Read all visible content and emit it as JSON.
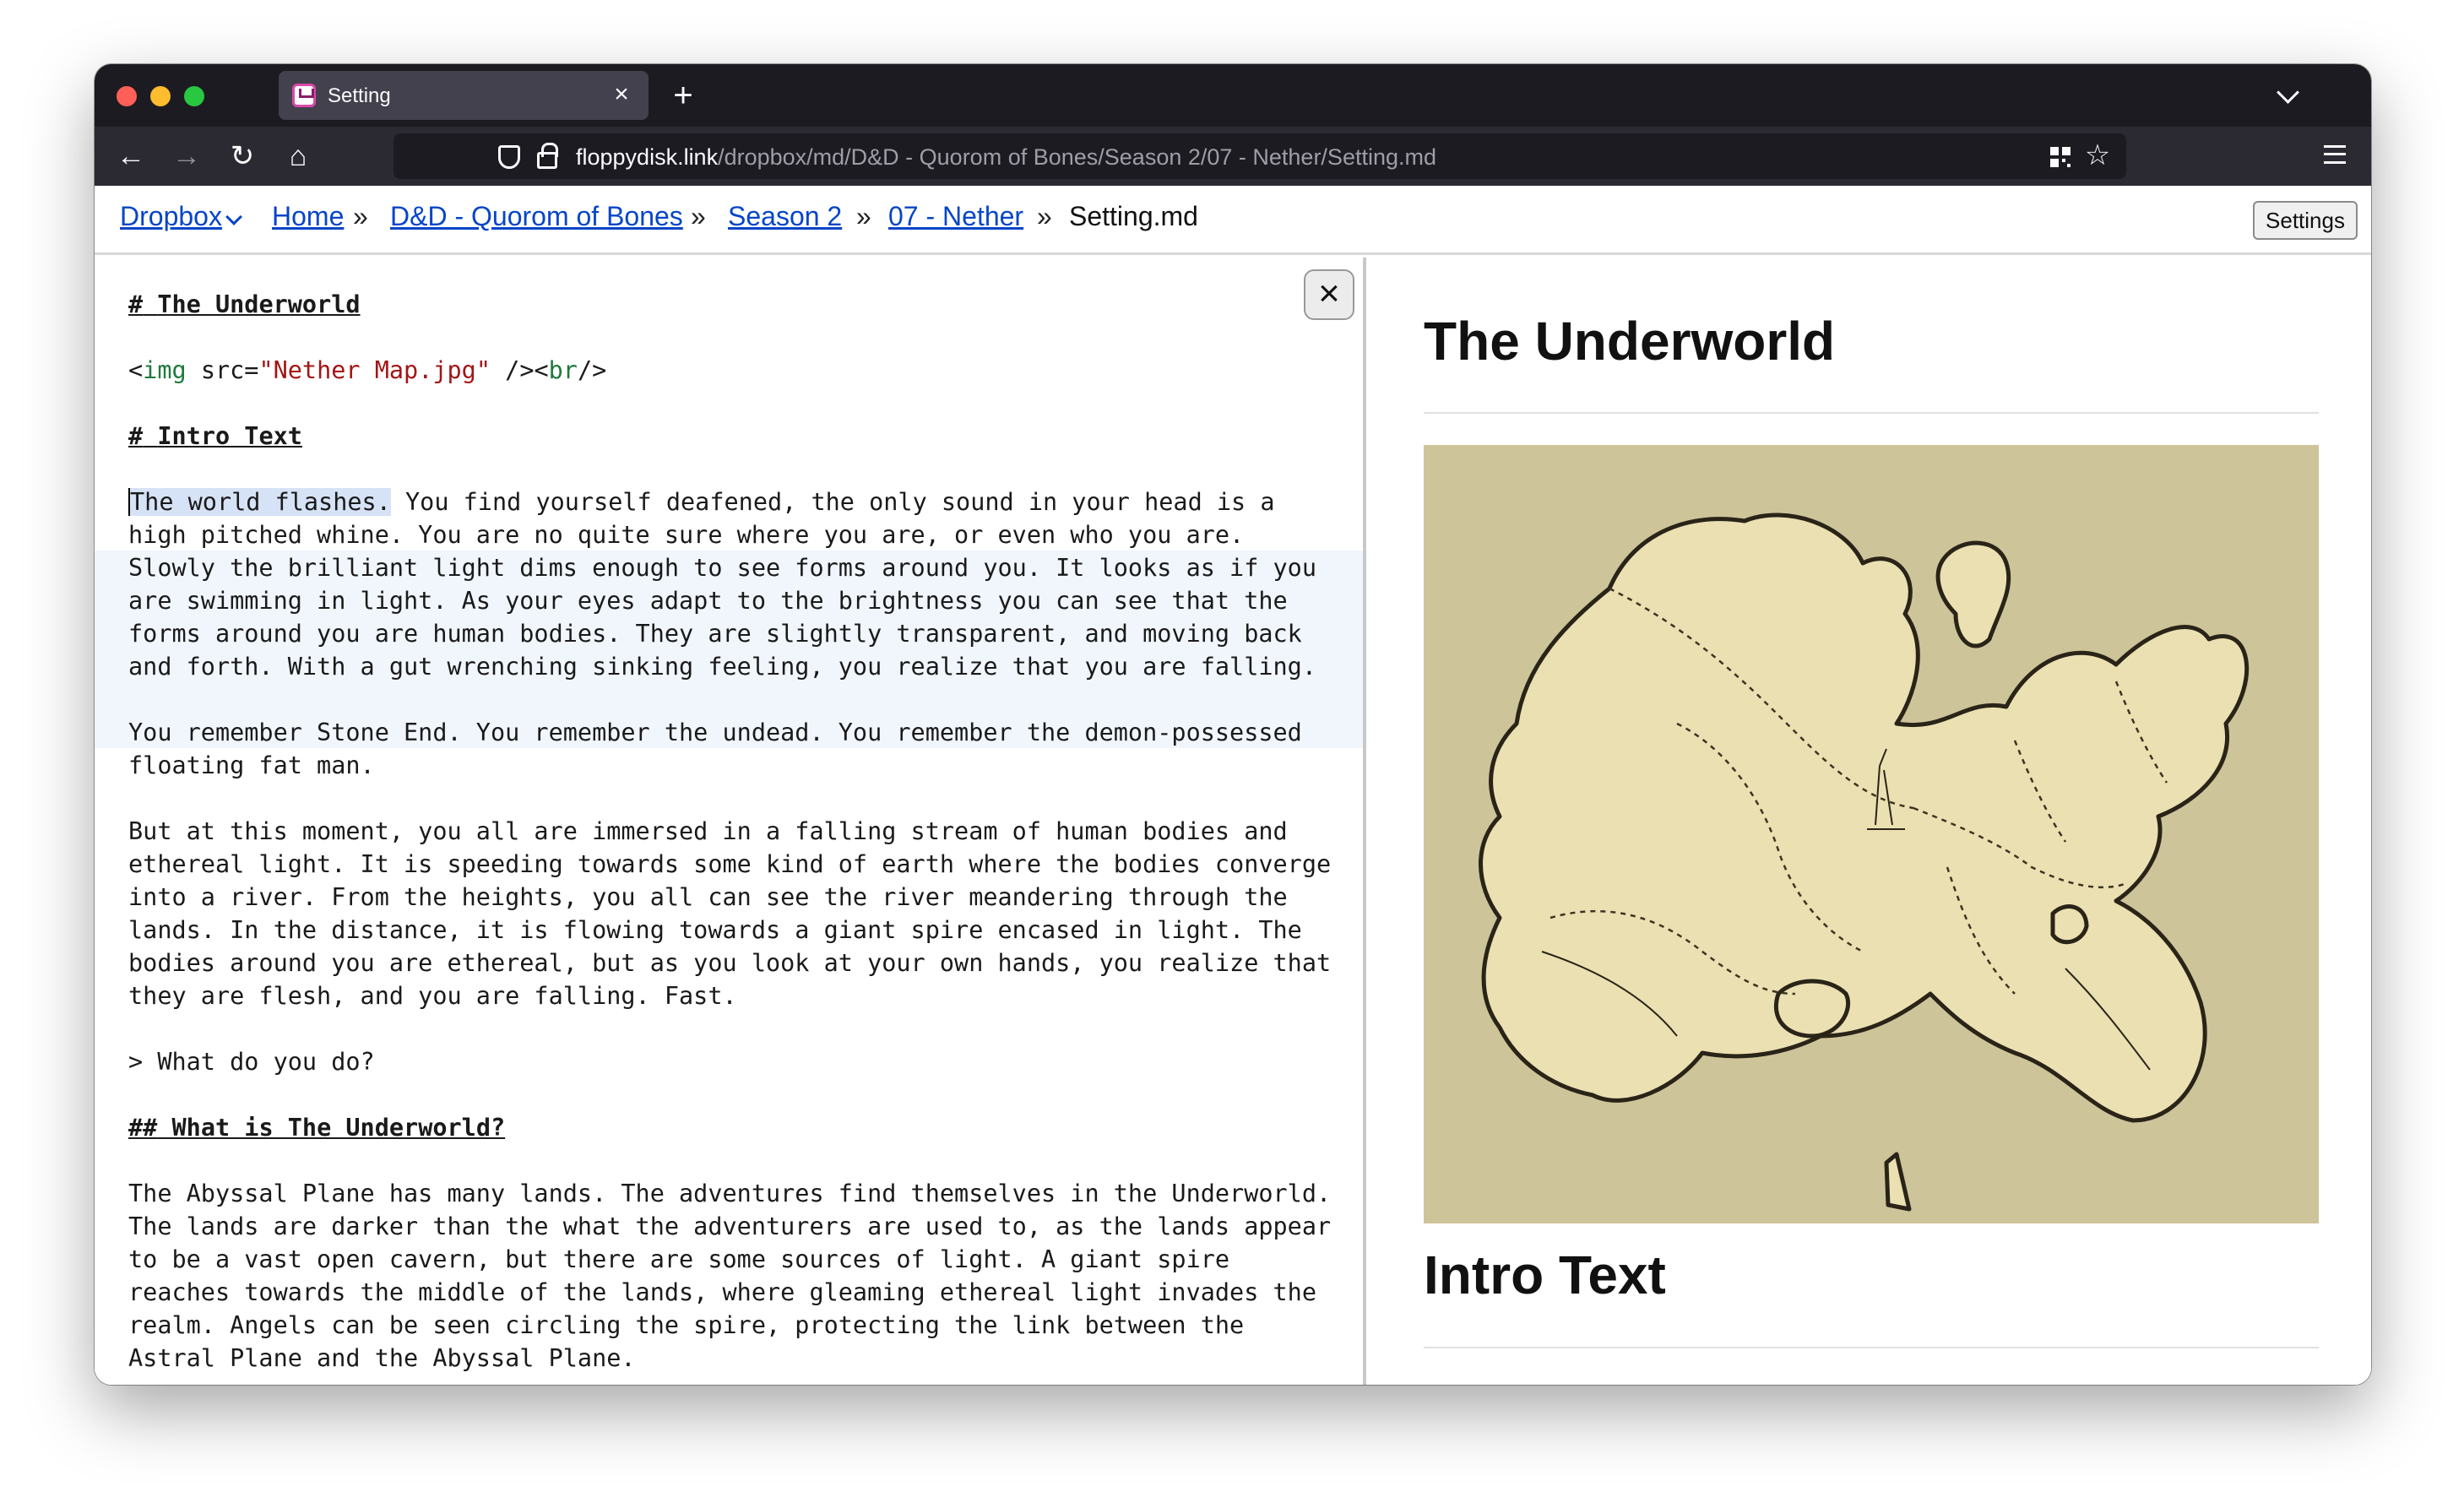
{
  "browser": {
    "tab_title": "Setting",
    "tab_close": "×",
    "new_tab": "+",
    "url_domain": "floppydisk.link",
    "url_path": "/dropbox/md/D&D - Quorom of Bones/Season 2/07 - Nether/Setting.md",
    "back": "←",
    "forward": "→",
    "reload": "↻",
    "home": "⌂",
    "star": "☆"
  },
  "breadcrumb": {
    "dropbox": "Dropbox",
    "home": "Home",
    "campaign": "D&D - Quorom of Bones",
    "season": "Season 2",
    "chapter": "07 - Nether",
    "current": "Setting.md",
    "sep": "»"
  },
  "settings_label": "Settings",
  "close_pane_label": "×",
  "editor": {
    "h_mark": "#",
    "h1_text": "The Underworld",
    "img_open": "<",
    "img_tag": "img",
    "img_attr": " src=",
    "img_src": "\"Nether Map.jpg\"",
    "img_mid": " /><",
    "br_tag": "br",
    "img_close": "/>",
    "h_intro": "Intro Text",
    "sel_text": "The world flashes.",
    "p1_rest": " You find yourself deafened, the only sound in your head is a",
    "p1": [
      "high pitched whine. You are no quite sure where you are, or even who you are.",
      "Slowly the brilliant light dims enough to see forms around you. It looks as if you",
      "are swimming in light. As your eyes adapt to the brightness you can see that the",
      "forms around you are human bodies. They are slightly transparent, and moving back",
      "and forth. With a gut wrenching sinking feeling, you realize that you are falling."
    ],
    "p2": [
      "You remember Stone End. You remember the undead. You remember the demon-possessed",
      "floating fat man."
    ],
    "p3": [
      "But at this moment, you all are immersed in a falling stream of human bodies and",
      "ethereal light. It is speeding towards some kind of earth where the bodies converge",
      "into a river. From the heights, you all can see the river meandering through the",
      "lands. In the distance, it is flowing towards a giant spire encased in light. The",
      "bodies around you are ethereal, but as you look at your own hands, you realize that",
      "they are flesh, and you are falling. Fast."
    ],
    "quote": "> What do you do?",
    "h2_mark": "##",
    "h2_text": "What is The Underworld?",
    "p4": [
      "The Abyssal Plane has many lands. The adventures find themselves in the Underworld.",
      "The lands are darker than the what the adventurers are used to, as the lands appear",
      "to be a vast open cavern, but there are some sources of light. A giant spire",
      "reaches towards the middle of the lands, where gleaming ethereal light invades the",
      "realm. Angels can be seen circling the spire, protecting the link between the",
      "Astral Plane and the Abyssal Plane."
    ]
  },
  "preview": {
    "h1": "The Underworld",
    "h2": "Intro Text",
    "map_colors": {
      "parchment": "#cec49a",
      "land": "#ebe0b2",
      "ink": "#2a2418"
    }
  }
}
